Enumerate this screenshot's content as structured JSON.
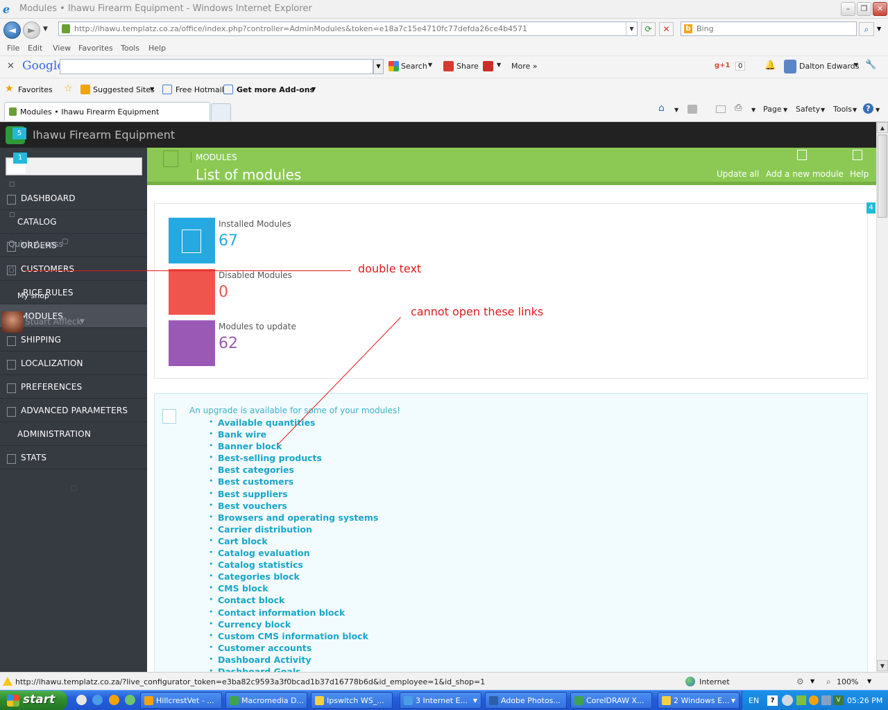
{
  "window": {
    "title": "Modules • Ihawu Firearm Equipment - Windows Internet Explorer"
  },
  "addressbar": {
    "url": "http://ihawu.templatz.co.za/office/index.php?controller=AdminModules&token=e18a7c15e4710fc77defda26ce4b4571",
    "search_placeholder": "Bing"
  },
  "menubar": [
    "File",
    "Edit",
    "View",
    "Favorites",
    "Tools",
    "Help"
  ],
  "google_toolbar": {
    "logo": "Google",
    "search_label": "Search",
    "share_label": "Share",
    "more_label": "More »",
    "plusone_label": "g+1",
    "plusone_count": "0",
    "user_name": "Dalton Edwards"
  },
  "favorites_bar": {
    "favorites": "Favorites",
    "suggested": "Suggested Sites",
    "hotmail": "Free Hotmail",
    "addons": "Get more Add-ons"
  },
  "tab": {
    "label": "Modules • Ihawu Firearm Equipment"
  },
  "command_bar": {
    "page": "Page",
    "safety": "Safety",
    "tools": "Tools"
  },
  "shop": {
    "name": "Ihawu Firearm Equipment",
    "notif_badge": "5",
    "sidebar_badge": "1",
    "side_tag": "4"
  },
  "sidebar": {
    "items": [
      {
        "label": "DASHBOARD"
      },
      {
        "label": "CATALOG"
      },
      {
        "label": "ORDERS"
      },
      {
        "label": "CUSTOMERS"
      },
      {
        "label": "RICE RULES"
      },
      {
        "label": "MODULES"
      },
      {
        "label": "SHIPPING"
      },
      {
        "label": "LOCALIZATION"
      },
      {
        "label": "PREFERENCES"
      },
      {
        "label": "ADVANCED PARAMETERS"
      },
      {
        "label": "ADMINISTRATION"
      },
      {
        "label": "STATS"
      }
    ],
    "quick_access": "Quick Access",
    "my_shop": "My shop",
    "employee": "Stuart Affleck"
  },
  "toolbar": {
    "breadcrumb": "MODULES",
    "title": "List of modules",
    "update_all": "Update all",
    "add_module": "Add a new module",
    "help": "Help"
  },
  "stats": {
    "installed_label": "Installed Modules",
    "installed_value": "67",
    "disabled_label": "Disabled Modules",
    "disabled_value": "0",
    "update_label": "Modules to update",
    "update_value": "62",
    "colors": {
      "installed": "#25a9e0",
      "disabled": "#f0554d",
      "update": "#9b59b6"
    }
  },
  "upgrade": {
    "message": "An upgrade is available for some of your modules!",
    "modules": [
      "Available quantities",
      "Bank wire",
      "Banner block",
      "Best-selling products",
      "Best categories",
      "Best customers",
      "Best suppliers",
      "Best vouchers",
      "Browsers and operating systems",
      "Carrier distribution",
      "Cart block",
      "Catalog evaluation",
      "Catalog statistics",
      "Categories block",
      "CMS block",
      "Contact block",
      "Contact information block",
      "Currency block",
      "Custom CMS information block",
      "Customer accounts",
      "Dashboard Activity",
      "Dashboard Goals"
    ]
  },
  "annotations": {
    "double_text": "double text",
    "cannot_open": "cannot open these links"
  },
  "statusbar": {
    "url": "http://ihawu.templatz.co.za/?live_configurator_token=e3ba82c9593a3f0bcad1b37d16778b6d&id_employee=1&id_shop=1",
    "zone": "Internet",
    "zoom": "100%"
  },
  "taskbar": {
    "start": "start",
    "items": [
      "HillcrestVet - ...",
      "Macromedia D...",
      "Ipswitch WS_...",
      "3 Internet E...",
      "Adobe Photos...",
      "CorelDRAW X...",
      "2 Windows E..."
    ],
    "lang": "EN",
    "clock": "05:26 PM"
  }
}
